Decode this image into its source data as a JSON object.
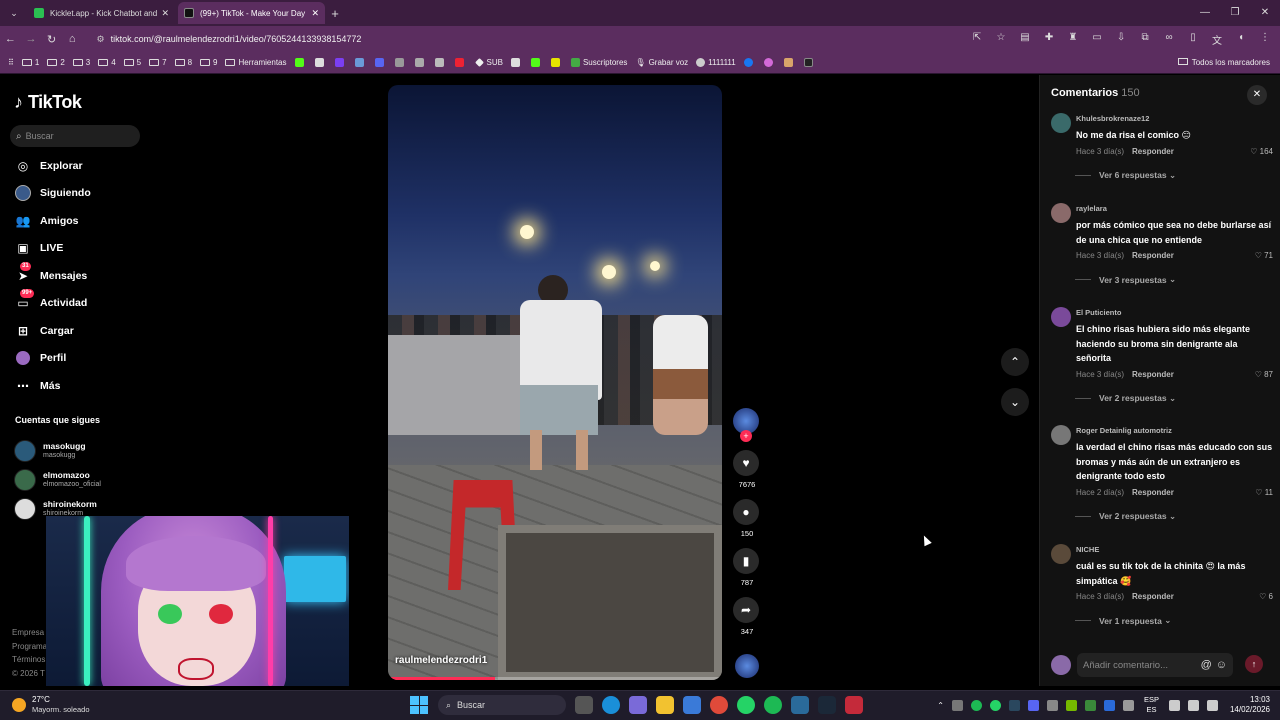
{
  "browser": {
    "tabs": [
      {
        "title": "Kicklet.app - Kick Chatbot and",
        "favicon_color": "#2bbf52",
        "active": false
      },
      {
        "title": "(99+) TikTok - Make Your Day",
        "favicon_color": "#111111",
        "active": true
      }
    ],
    "url": "tiktok.com/@raulmelendezrodri1/video/7605244133938154772",
    "bookmarks": [
      {
        "label": "1",
        "kind": "folder"
      },
      {
        "label": "2",
        "kind": "folder"
      },
      {
        "label": "3",
        "kind": "folder"
      },
      {
        "label": "4",
        "kind": "folder"
      },
      {
        "label": "5",
        "kind": "folder"
      },
      {
        "label": "7",
        "kind": "folder"
      },
      {
        "label": "8",
        "kind": "folder"
      },
      {
        "label": "9",
        "kind": "folder"
      },
      {
        "label": "Herramientas",
        "kind": "folder"
      },
      {
        "label": "SUB",
        "kind": "site"
      },
      {
        "label": "Suscriptores",
        "kind": "site"
      },
      {
        "label": "Grabar voz",
        "kind": "site"
      },
      {
        "label": "1111111",
        "kind": "site"
      }
    ],
    "bookmarks_all": "Todos los marcadores"
  },
  "sidebar": {
    "logo": "TikTok",
    "search_placeholder": "Buscar",
    "nav": [
      {
        "label": "Explorar",
        "icon": "compass-icon",
        "glyph": "◎"
      },
      {
        "label": "Siguiendo",
        "icon": "following-icon",
        "glyph": "●"
      },
      {
        "label": "Amigos",
        "icon": "friends-icon",
        "glyph": "♟"
      },
      {
        "label": "LIVE",
        "icon": "live-icon",
        "glyph": "▣"
      },
      {
        "label": "Mensajes",
        "icon": "messages-icon",
        "glyph": "✈",
        "badge": "31"
      },
      {
        "label": "Actividad",
        "icon": "activity-icon",
        "glyph": "▭",
        "badge": "99+"
      },
      {
        "label": "Cargar",
        "icon": "upload-icon",
        "glyph": "⊞"
      },
      {
        "label": "Perfil",
        "icon": "profile-icon",
        "glyph": "●"
      },
      {
        "label": "Más",
        "icon": "more-icon",
        "glyph": "⋯"
      }
    ],
    "following_title": "Cuentas que sigues",
    "following": [
      {
        "name": "masokugg",
        "user": "masokugg"
      },
      {
        "name": "elmomazoo",
        "user": "elmomazoo_oficial"
      },
      {
        "name": "shiroinekorm",
        "user": "shiroinekorm"
      }
    ],
    "footer": [
      "Empresa",
      "Programa",
      "Términos",
      "© 2026 T"
    ]
  },
  "video": {
    "author": "raulmelendezrodri1",
    "progress": 0.32,
    "likes": "7676",
    "comments": "150",
    "saves": "787",
    "shares": "347"
  },
  "comments": {
    "title": "Comentarios",
    "count": "150",
    "input_placeholder": "Añadir comentario...",
    "items": [
      {
        "user": "Khulesbrokrenaze12",
        "text": "No me da risa el comico 😑",
        "time": "Hace 3 día(s)",
        "reply": "Responder",
        "likes": "164",
        "replies": "Ver 6 respuestas",
        "avatar": "#3a6a6a"
      },
      {
        "user": "raylelara",
        "text": "por más cómico que sea no debe burlarse así de una chica que no entiende",
        "time": "Hace 3 día(s)",
        "reply": "Responder",
        "likes": "71",
        "replies": "Ver 3 respuestas",
        "avatar": "#8a6a6a"
      },
      {
        "user": "El Puticiento",
        "text": "El chino risas hubiera sido más elegante haciendo su broma sin denigrante ala señorita",
        "time": "Hace 3 día(s)",
        "reply": "Responder",
        "likes": "87",
        "replies": "Ver 2 respuestas",
        "avatar": "#7a4a9a"
      },
      {
        "user": "Roger Detainlig automotriz",
        "text": "la verdad el chino risas más educado con sus bromas y más aún de un extranjero es denigrante todo esto",
        "time": "Hace 2 día(s)",
        "reply": "Responder",
        "likes": "11",
        "replies": "Ver 2 respuestas",
        "avatar": "#777777"
      },
      {
        "user": "NICHE",
        "text": "cuál es su tik tok de la chinita 😍 la más simpática 🥰",
        "time": "Hace 3 día(s)",
        "reply": "Responder",
        "likes": "6",
        "replies": "Ver 1 respuesta",
        "avatar": "#5a4a3a"
      }
    ]
  },
  "taskbar": {
    "temp": "27°C",
    "weather": "Mayorm. soleado",
    "search": "Buscar",
    "lang_top": "ESP",
    "lang_bottom": "ES",
    "time": "13:03",
    "date": "14/02/2026"
  }
}
